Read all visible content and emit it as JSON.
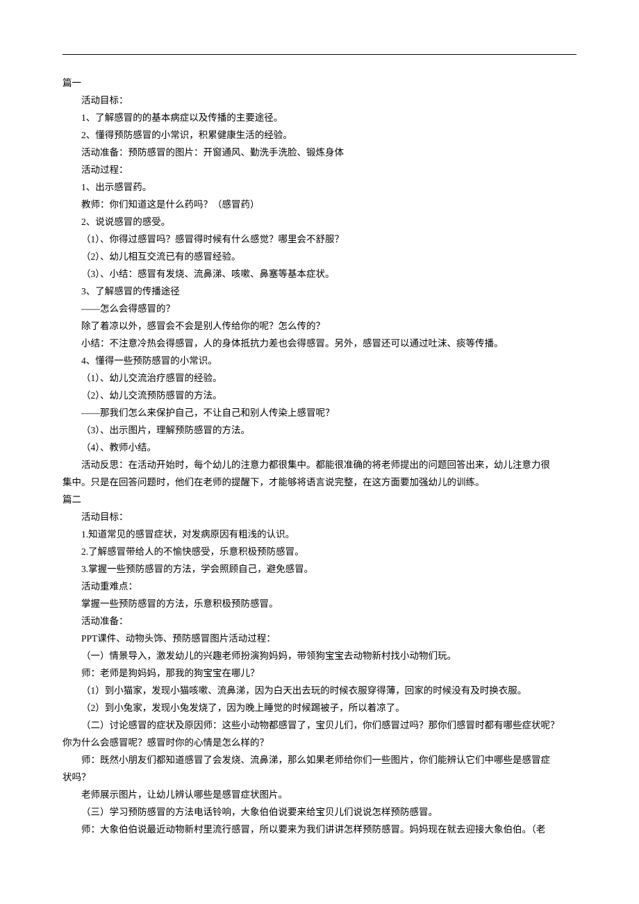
{
  "lines": [
    {
      "cls": "heading",
      "text": "篇一"
    },
    {
      "cls": "indent1",
      "text": "活动目标："
    },
    {
      "cls": "indent1",
      "text": "1、了解感冒的的基本病症以及传播的主要途径。"
    },
    {
      "cls": "indent1",
      "text": "2、懂得预防感冒的小常识，积累健康生活的经验。"
    },
    {
      "cls": "indent1",
      "text": "活动准备：预防感冒的图片：开窗通风、勤洗手洗脸、锻炼身体"
    },
    {
      "cls": "indent1",
      "text": "活动过程："
    },
    {
      "cls": "indent1",
      "text": "1、出示感冒药。"
    },
    {
      "cls": "indent1",
      "text": "教师：你们知道这是什么药吗？（感冒药）"
    },
    {
      "cls": "indent1",
      "text": "2、说说感冒的感受。"
    },
    {
      "cls": "indent1",
      "text": "（1）、你得过感冒吗？感冒得时候有什么感觉？哪里会不舒服？"
    },
    {
      "cls": "indent1",
      "text": "（2）、幼儿相互交流已有的感冒经验。"
    },
    {
      "cls": "indent1",
      "text": "（3）、小结：感冒有发烧、流鼻涕、咳嗽、鼻塞等基本症状。"
    },
    {
      "cls": "indent1",
      "text": "3、了解感冒的传播途径"
    },
    {
      "cls": "indent1",
      "text": "——怎么会得感冒的？"
    },
    {
      "cls": "indent1",
      "text": "除了着凉以外，感冒会不会是别人传给你的呢？怎么传的？"
    },
    {
      "cls": "indent1",
      "text": "小结：不注意冷热会得感冒，人的身体抵抗力差也会得感冒。另外，感冒还可以通过吐沫、痰等传播。"
    },
    {
      "cls": "indent1",
      "text": "4、懂得一些预防感冒的小常识。"
    },
    {
      "cls": "indent1",
      "text": "（1）、幼儿交流治疗感冒的经验。"
    },
    {
      "cls": "indent1",
      "text": "（2）、幼儿交流预防感冒的方法。"
    },
    {
      "cls": "indent1",
      "text": "——那我们怎么来保护自己，不让自己和别人传染上感冒呢？"
    },
    {
      "cls": "indent1",
      "text": "（3）、出示图片，理解预防感冒的方法。"
    },
    {
      "cls": "indent1",
      "text": "（4）、教师小结。"
    },
    {
      "cls": "indent1",
      "text": "活动反思：在活动开始时，每个幼儿的注意力都很集中。都能很准确的将老师提出的问题回答出来，幼儿注意力很"
    },
    {
      "cls": "indent0",
      "text": "集中。只是在回答问题时，他们在老师的提醒下，才能够将语言说完整，在这方面要加强幼儿的训练。"
    },
    {
      "cls": "heading",
      "text": "篇二"
    },
    {
      "cls": "indent1",
      "text": "活动目标："
    },
    {
      "cls": "indent1",
      "text": "1.知道常见的感冒症状，对发病原因有粗浅的认识。"
    },
    {
      "cls": "indent1",
      "text": "2.了解感冒带给人的不愉快感受，乐意积极预防感冒。"
    },
    {
      "cls": "indent1",
      "text": "3.掌握一些预防感冒的方法，学会照顾自己，避免感冒。"
    },
    {
      "cls": "indent1",
      "text": "活动重难点："
    },
    {
      "cls": "indent1",
      "text": "掌握一些预防感冒的方法，乐意积极预防感冒。"
    },
    {
      "cls": "indent1",
      "text": "活动准备："
    },
    {
      "cls": "indent1",
      "text": "PPT课件、动物头饰、预防感冒图片活动过程："
    },
    {
      "cls": "indent1",
      "text": "（一）情景导入，激发幼儿的兴趣老师扮演狗妈妈，带领狗宝宝去动物新村找小动物们玩。"
    },
    {
      "cls": "indent1",
      "text": "师：老师是狗妈妈，那我的狗宝宝在哪儿？"
    },
    {
      "cls": "indent1",
      "text": "（1）到小猫家，发现小猫咳嗽、流鼻涕，因为白天出去玩的时候衣服穿得薄，回家的时候没有及时换衣服。"
    },
    {
      "cls": "indent1",
      "text": "（2）到小兔家，发现小兔发烧了，因为晚上睡觉的时候踢被子，所以着凉了。"
    },
    {
      "cls": "indent1",
      "text": "（二）讨论感冒的症状及原因师：这些小动物都感冒了，宝贝儿们，你们感冒过吗？那你们感冒时都有哪些症状呢？"
    },
    {
      "cls": "indent0",
      "text": "你为什么会感冒呢？感冒时你的心情是怎么样的？"
    },
    {
      "cls": "indent1",
      "text": "师：既然小朋友们都知道感冒了会发烧、流鼻涕，那么如果老师给你们一些图片，你们能辨认它们中哪些是感冒症"
    },
    {
      "cls": "indent0",
      "text": "状吗？"
    },
    {
      "cls": "indent1",
      "text": "老师展示图片，让幼儿辨认哪些是感冒症状图片。"
    },
    {
      "cls": "indent1",
      "text": "（三）学习预防感冒的方法电话铃响，大象伯伯说要来给宝贝儿们说说怎样预防感冒。"
    },
    {
      "cls": "indent1",
      "text": "师：大象伯伯说最近动物新村里流行感冒，所以要来为我们讲讲怎样预防感冒。妈妈现在就去迎接大象伯伯。（老"
    }
  ]
}
